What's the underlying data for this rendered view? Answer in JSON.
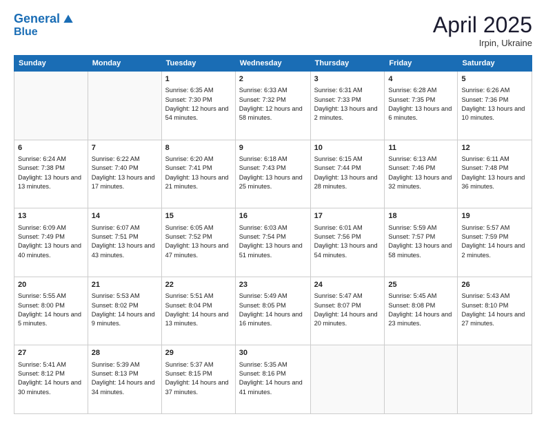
{
  "logo": {
    "line1": "General",
    "line2": "Blue"
  },
  "title": "April 2025",
  "location": "Irpin, Ukraine",
  "weekdays": [
    "Sunday",
    "Monday",
    "Tuesday",
    "Wednesday",
    "Thursday",
    "Friday",
    "Saturday"
  ],
  "weeks": [
    [
      {
        "day": null,
        "text": null
      },
      {
        "day": null,
        "text": null
      },
      {
        "day": "1",
        "text": "Sunrise: 6:35 AM\nSunset: 7:30 PM\nDaylight: 12 hours\nand 54 minutes."
      },
      {
        "day": "2",
        "text": "Sunrise: 6:33 AM\nSunset: 7:32 PM\nDaylight: 12 hours\nand 58 minutes."
      },
      {
        "day": "3",
        "text": "Sunrise: 6:31 AM\nSunset: 7:33 PM\nDaylight: 13 hours\nand 2 minutes."
      },
      {
        "day": "4",
        "text": "Sunrise: 6:28 AM\nSunset: 7:35 PM\nDaylight: 13 hours\nand 6 minutes."
      },
      {
        "day": "5",
        "text": "Sunrise: 6:26 AM\nSunset: 7:36 PM\nDaylight: 13 hours\nand 10 minutes."
      }
    ],
    [
      {
        "day": "6",
        "text": "Sunrise: 6:24 AM\nSunset: 7:38 PM\nDaylight: 13 hours\nand 13 minutes."
      },
      {
        "day": "7",
        "text": "Sunrise: 6:22 AM\nSunset: 7:40 PM\nDaylight: 13 hours\nand 17 minutes."
      },
      {
        "day": "8",
        "text": "Sunrise: 6:20 AM\nSunset: 7:41 PM\nDaylight: 13 hours\nand 21 minutes."
      },
      {
        "day": "9",
        "text": "Sunrise: 6:18 AM\nSunset: 7:43 PM\nDaylight: 13 hours\nand 25 minutes."
      },
      {
        "day": "10",
        "text": "Sunrise: 6:15 AM\nSunset: 7:44 PM\nDaylight: 13 hours\nand 28 minutes."
      },
      {
        "day": "11",
        "text": "Sunrise: 6:13 AM\nSunset: 7:46 PM\nDaylight: 13 hours\nand 32 minutes."
      },
      {
        "day": "12",
        "text": "Sunrise: 6:11 AM\nSunset: 7:48 PM\nDaylight: 13 hours\nand 36 minutes."
      }
    ],
    [
      {
        "day": "13",
        "text": "Sunrise: 6:09 AM\nSunset: 7:49 PM\nDaylight: 13 hours\nand 40 minutes."
      },
      {
        "day": "14",
        "text": "Sunrise: 6:07 AM\nSunset: 7:51 PM\nDaylight: 13 hours\nand 43 minutes."
      },
      {
        "day": "15",
        "text": "Sunrise: 6:05 AM\nSunset: 7:52 PM\nDaylight: 13 hours\nand 47 minutes."
      },
      {
        "day": "16",
        "text": "Sunrise: 6:03 AM\nSunset: 7:54 PM\nDaylight: 13 hours\nand 51 minutes."
      },
      {
        "day": "17",
        "text": "Sunrise: 6:01 AM\nSunset: 7:56 PM\nDaylight: 13 hours\nand 54 minutes."
      },
      {
        "day": "18",
        "text": "Sunrise: 5:59 AM\nSunset: 7:57 PM\nDaylight: 13 hours\nand 58 minutes."
      },
      {
        "day": "19",
        "text": "Sunrise: 5:57 AM\nSunset: 7:59 PM\nDaylight: 14 hours\nand 2 minutes."
      }
    ],
    [
      {
        "day": "20",
        "text": "Sunrise: 5:55 AM\nSunset: 8:00 PM\nDaylight: 14 hours\nand 5 minutes."
      },
      {
        "day": "21",
        "text": "Sunrise: 5:53 AM\nSunset: 8:02 PM\nDaylight: 14 hours\nand 9 minutes."
      },
      {
        "day": "22",
        "text": "Sunrise: 5:51 AM\nSunset: 8:04 PM\nDaylight: 14 hours\nand 13 minutes."
      },
      {
        "day": "23",
        "text": "Sunrise: 5:49 AM\nSunset: 8:05 PM\nDaylight: 14 hours\nand 16 minutes."
      },
      {
        "day": "24",
        "text": "Sunrise: 5:47 AM\nSunset: 8:07 PM\nDaylight: 14 hours\nand 20 minutes."
      },
      {
        "day": "25",
        "text": "Sunrise: 5:45 AM\nSunset: 8:08 PM\nDaylight: 14 hours\nand 23 minutes."
      },
      {
        "day": "26",
        "text": "Sunrise: 5:43 AM\nSunset: 8:10 PM\nDaylight: 14 hours\nand 27 minutes."
      }
    ],
    [
      {
        "day": "27",
        "text": "Sunrise: 5:41 AM\nSunset: 8:12 PM\nDaylight: 14 hours\nand 30 minutes."
      },
      {
        "day": "28",
        "text": "Sunrise: 5:39 AM\nSunset: 8:13 PM\nDaylight: 14 hours\nand 34 minutes."
      },
      {
        "day": "29",
        "text": "Sunrise: 5:37 AM\nSunset: 8:15 PM\nDaylight: 14 hours\nand 37 minutes."
      },
      {
        "day": "30",
        "text": "Sunrise: 5:35 AM\nSunset: 8:16 PM\nDaylight: 14 hours\nand 41 minutes."
      },
      {
        "day": null,
        "text": null
      },
      {
        "day": null,
        "text": null
      },
      {
        "day": null,
        "text": null
      }
    ]
  ]
}
